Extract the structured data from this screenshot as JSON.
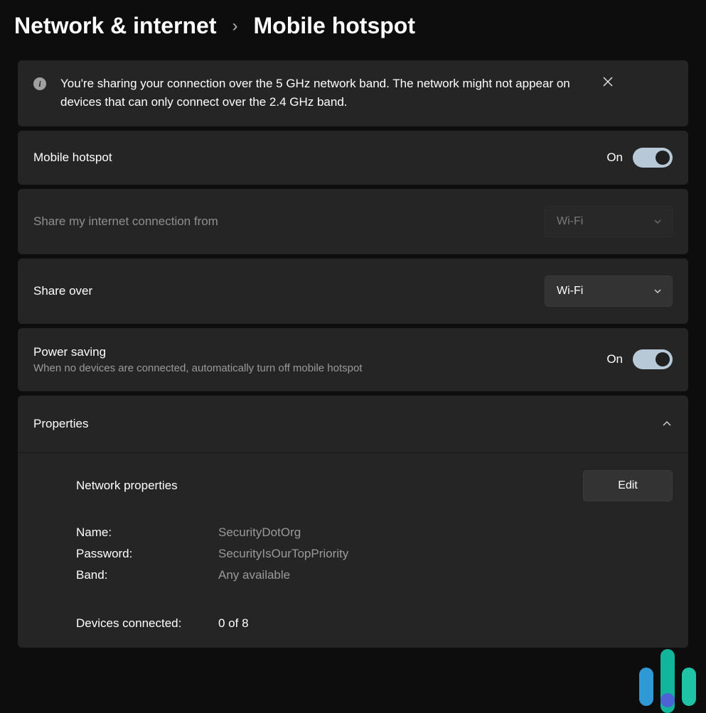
{
  "breadcrumb": {
    "parent": "Network & internet",
    "separator": "›",
    "current": "Mobile hotspot"
  },
  "banner": {
    "text": "You're sharing your connection over the 5 GHz network band. The network might not appear on devices that can only connect over the 2.4 GHz band."
  },
  "hotspot_toggle": {
    "label": "Mobile hotspot",
    "state_text": "On"
  },
  "share_from": {
    "label": "Share my internet connection from",
    "value": "Wi-Fi"
  },
  "share_over": {
    "label": "Share over",
    "value": "Wi-Fi"
  },
  "power_saving": {
    "label": "Power saving",
    "sub": "When no devices are connected, automatically turn off mobile hotspot",
    "state_text": "On"
  },
  "properties": {
    "header": "Properties",
    "network_properties_label": "Network properties",
    "edit_label": "Edit",
    "name_key": "Name:",
    "name_val": "SecurityDotOrg",
    "password_key": "Password:",
    "password_val": "SecurityIsOurTopPriority",
    "band_key": "Band:",
    "band_val": "Any available",
    "devices_key": "Devices connected:",
    "devices_val": "0 of 8"
  }
}
